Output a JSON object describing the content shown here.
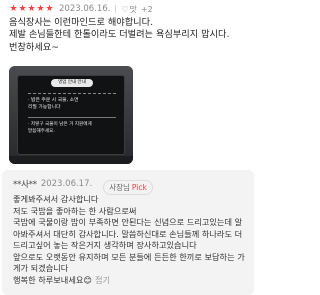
{
  "review": {
    "rating_stars": [
      "★",
      "★",
      "★",
      "★",
      "★"
    ],
    "date": "2023.06.16.",
    "taste_icon": "heart-icon",
    "taste_icon_glyph": "♡",
    "taste_label": "맛",
    "plus_label": "+2",
    "text": "음식장사는 이런마인드로 해야합니다.\n제발 손님들한테 한톨이라도 더벌려는 욕심부리지 맙시다.\n번창하세요~"
  },
  "photo": {
    "sign_title": "영업 안내 안내",
    "line1": "· 밥은 주문 시 국물, 소면",
    "line2": "  리필 가능합니다",
    "line3": "· 저렇구 국물이 남은 거 지원에게",
    "line4": "  말씀해주세요."
  },
  "owner_pick": {
    "label": "사장님",
    "pick": "Pick"
  },
  "reply": {
    "name": "**사**",
    "date": "2023.06.17.",
    "text": "좋게봐주셔서 감사합니다\n저도 국밥을 좋아하는 한 사람으로써\n국밥에 국물이랑 밥이 부족하면 안된다는 신념으로 드리고있는데 알아봐주셔서 대단히 감사합니다. 말씀하신대로 손님들께 하나라도 더 드리고싶어 놓는 작은거지 생각하며 장사하고있습니다\n앞으로도 오랫동안 유지하며 모든 분들에 든든한 한끼로 보답하는 가게가 되겠습니다\n행복한 하루보내세요😊",
    "more_label": "접기"
  },
  "colors": {
    "star": "#fa3e3e",
    "reply_bg": "#f3f3f3",
    "muted": "#8a8a8a"
  }
}
